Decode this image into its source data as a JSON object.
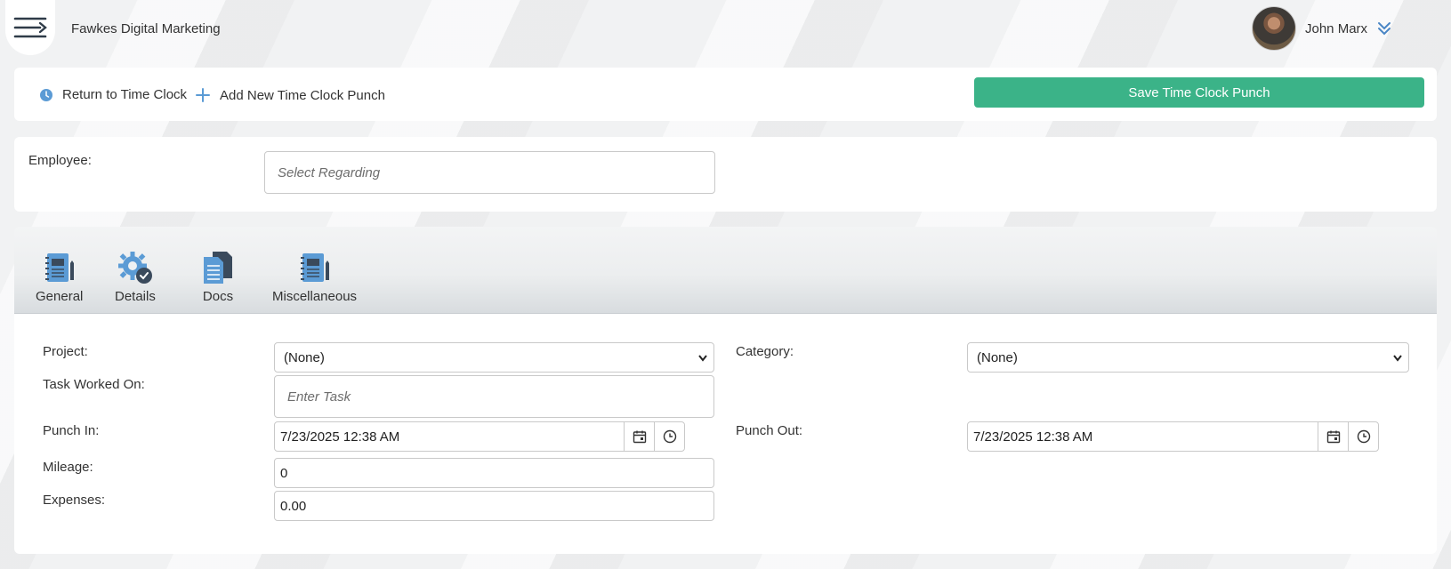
{
  "app": {
    "title": "Fawkes Digital Marketing"
  },
  "user": {
    "name": "John Marx"
  },
  "actions": {
    "return_label": "Return to Time Clock",
    "add_label": "Add New Time Clock Punch",
    "save_label": "Save Time Clock Punch"
  },
  "employee": {
    "label": "Employee:",
    "placeholder": "Select Regarding"
  },
  "tabs": [
    {
      "label": "General",
      "icon": "notebook-pencil-icon"
    },
    {
      "label": "Details",
      "icon": "gear-check-icon"
    },
    {
      "label": "Docs",
      "icon": "documents-icon"
    },
    {
      "label": "Miscellaneous",
      "icon": "notebook-pencil-icon"
    }
  ],
  "form": {
    "project": {
      "label": "Project:",
      "value": "(None)"
    },
    "category": {
      "label": "Category:",
      "value": "(None)"
    },
    "task": {
      "label": "Task Worked On:",
      "placeholder": "Enter Task"
    },
    "punch_in": {
      "label": "Punch In:",
      "value": "7/23/2025 12:38 AM"
    },
    "punch_out": {
      "label": "Punch Out:",
      "value": "7/23/2025 12:38 AM"
    },
    "mileage": {
      "label": "Mileage:",
      "value": "0"
    },
    "expenses": {
      "label": "Expenses:",
      "value": "0.00"
    }
  },
  "colors": {
    "accent": "#3bb388",
    "icon_blue": "#5b9bd5",
    "icon_dark": "#3a4a5c"
  }
}
